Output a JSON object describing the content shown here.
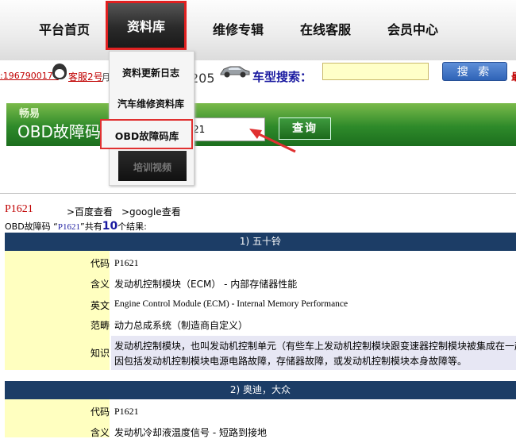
{
  "nav": {
    "items": [
      "平台首页",
      "资料库",
      "维修专辑",
      "在线客服",
      "会员中心"
    ]
  },
  "topbar": {
    "qq_number": ":1967900174",
    "qq_link": "客服2号",
    "cs_suffix_a": "月",
    "cs_suffix_b": "205",
    "search_label": "车型搜索：",
    "search_button": "搜 索",
    "right_edge": "最"
  },
  "dropdown": {
    "items": [
      "资料更新日志",
      "汽车维修资料库",
      "OBD故障码库",
      "培训视频"
    ]
  },
  "banner": {
    "brand": "畅易",
    "title": "OBD故障码",
    "input_value": "21",
    "query_button": "查询"
  },
  "results": {
    "code": "P1621",
    "baidu": ">百度查看",
    "google": ">google查看",
    "summary_prefix": "OBD故障码 “",
    "summary_code": "P1621",
    "summary_mid": "”共有",
    "summary_count": "10",
    "summary_suffix": "个结果:",
    "sections": [
      {
        "title": "1) 五十铃",
        "labels": {
          "code": "代码",
          "meaning": "含义",
          "english": "英文",
          "scope": "范畴",
          "knowledge": "知识"
        },
        "code": "P1621",
        "meaning": "发动机控制模块（ECM） - 内部存储器性能",
        "english": "Engine Control Module (ECM) - Internal Memory Performance",
        "scope": "动力总成系统（制造商自定义）",
        "knowledge_line1": "发动机控制模块，也叫发动机控制单元（有些车上发动机控制模块跟变速器控制模块被集成在一起",
        "knowledge_line2": "因包括发动机控制模块电源电路故障，存储器故障，或发动机控制模块本身故障等。"
      },
      {
        "title": "2) 奥迪，大众",
        "labels": {
          "code": "代码",
          "meaning": "含义"
        },
        "code": "P1621",
        "meaning": "发动机冷却液温度信号 - 短路到接地"
      }
    ]
  }
}
